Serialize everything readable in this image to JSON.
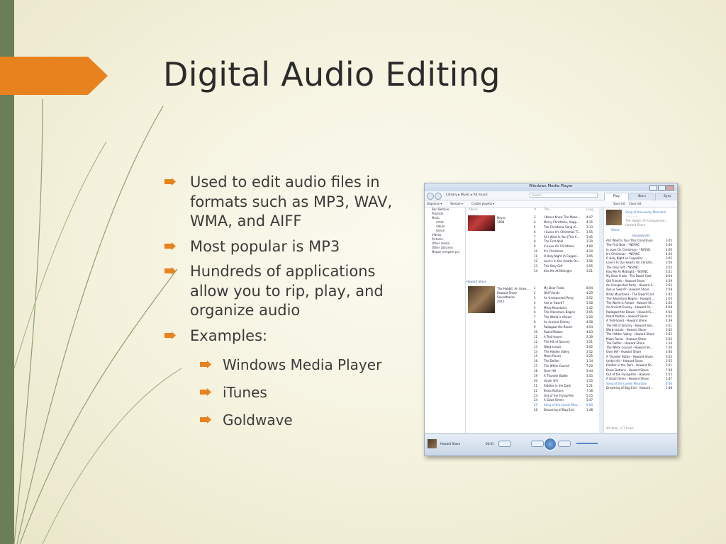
{
  "slide": {
    "title": "Digital Audio Editing",
    "bullets": [
      {
        "level": 1,
        "text": "Used to edit audio files in formats such as MP3, WAV, WMA, and AIFF"
      },
      {
        "level": 1,
        "text": "Most popular is MP3"
      },
      {
        "level": 1,
        "text": "Hundreds of applications allow you to rip, play, and organize audio"
      },
      {
        "level": 1,
        "text": "Examples:"
      },
      {
        "level": 2,
        "text": "Windows Media Player"
      },
      {
        "level": 2,
        "text": "iTunes"
      },
      {
        "level": 2,
        "text": "Goldwave"
      }
    ],
    "colors": {
      "accent": "#e8821e",
      "left_bar": "#6a7f55",
      "curves": "#8a9a6a",
      "bullet": "#e8821e"
    }
  },
  "wmp": {
    "window_title": "Windows Media Player",
    "breadcrumb": "Library ▸ Music ▸ All music",
    "search_placeholder": "Search",
    "tabs": [
      "Play",
      "Burn",
      "Sync"
    ],
    "toolbar": {
      "organize": "Organize ▾",
      "stream": "Stream ▾",
      "create_playlist": "Create playlist ▾",
      "save_list": "Save list",
      "clear_list": "Clear list"
    },
    "nav_items": [
      "Ben Beltone",
      "Playlists",
      "Music",
      "Artist",
      "Album",
      "Genre",
      "Videos",
      "Pictures",
      "Other media",
      "Other Libraries",
      "Megan (megam-pc)"
    ],
    "columns": {
      "album": "Album",
      "num": "#",
      "title": "Title",
      "length": "Leng..."
    },
    "album1": {
      "title": "Nsync",
      "year": "1998",
      "group": ""
    },
    "album1_tracks": [
      [
        "3",
        "I Never Knew The Mean...",
        "4:47"
      ],
      [
        "4",
        "Merry Christmas, Happ...",
        "4:15"
      ],
      [
        "5",
        "The Christmas Song (C...",
        "3:13"
      ],
      [
        "6",
        "I Guess It's Christmas Ti...",
        "3:55"
      ],
      [
        "7",
        "All I Want Is You (This C...",
        "3:45"
      ],
      [
        "8",
        "The First Noel",
        "3:30"
      ],
      [
        "9",
        "In Love On Christmas",
        "4:00"
      ],
      [
        "10",
        "It's Christmas",
        "4:20"
      ],
      [
        "11",
        "O Holy Night (A Cappel...",
        "3:05"
      ],
      [
        "12",
        "Love's In Our Hearts On...",
        "3:56"
      ],
      [
        "13",
        "The Only Gift",
        "3:55"
      ],
      [
        "14",
        "Kiss Me At Midnight",
        "3:21"
      ]
    ],
    "album2": {
      "group": "Howard Shore",
      "title": "The Hobbit: An Unex...",
      "artist": "Howard Shore",
      "genre": "Soundtracks",
      "year": "2012"
    },
    "album2_tracks": [
      [
        "1",
        "My Dear Frodo",
        "8:04"
      ],
      [
        "2",
        "Old Friends",
        "4:29"
      ],
      [
        "3",
        "An Unexpected Party",
        "3:52"
      ],
      [
        "4",
        "Axe or Sword?",
        "5:58"
      ],
      [
        "5",
        "Misty Mountains",
        "1:42"
      ],
      [
        "6",
        "The Adventure Begins",
        "2:05"
      ],
      [
        "7",
        "The World is Ahead",
        "2:20"
      ],
      [
        "8",
        "An Ancient Enemy",
        "4:58"
      ],
      [
        "9",
        "Radagast the Brown",
        "4:54"
      ],
      [
        "10",
        "Roast Mutton",
        "4:03"
      ],
      [
        "11",
        "A Troll-hoard",
        "2:39"
      ],
      [
        "12",
        "The Hill of Sorcery",
        "3:51"
      ],
      [
        "13",
        "Warg-scouts",
        "3:02"
      ],
      [
        "14",
        "The Hidden Valley",
        "3:52"
      ],
      [
        "15",
        "Moon Runes",
        "3:25"
      ],
      [
        "16",
        "The Defiler",
        "1:14"
      ],
      [
        "17",
        "The White Council",
        "7:20"
      ],
      [
        "18",
        "Over Hill",
        "3:44"
      ],
      [
        "19",
        "A Thunder Battle",
        "3:55"
      ],
      [
        "20",
        "Under Hill",
        "1:55"
      ],
      [
        "21",
        "Riddles in the Dark",
        "5:21"
      ],
      [
        "22",
        "Brass Buttons",
        "7:38"
      ],
      [
        "23",
        "Out of the Frying-Pan",
        "5:55"
      ],
      [
        "24",
        "A Good Omen",
        "5:47"
      ],
      [
        "25",
        "Song of the Lonely Mou...",
        "6:00"
      ],
      [
        "26",
        "Dreaming of Bag End",
        "1:48"
      ]
    ],
    "now_playing": {
      "song": "Song of the Lonely Mountain",
      "album": "The Hobbit: An Unexpected...",
      "artist": "Howard Shore",
      "share": "Share"
    },
    "unsaved_list": "Unsaved list",
    "playlist": [
      [
        "All I Want Is You (This Christmas)",
        "3:45"
      ],
      [
        "The First Noel - *NSYNC",
        "3:30"
      ],
      [
        "In Love On Christmas - *NSYNC",
        "4:00"
      ],
      [
        "It's Christmas - *NSYNC",
        "4:20"
      ],
      [
        "O Holy Night (A Cappella)",
        "3:05"
      ],
      [
        "Love's In Our Hearts On Christm...",
        "3:56"
      ],
      [
        "The Only Gift - *NSYNC",
        "3:55"
      ],
      [
        "Kiss Me At Midnight - *NSYNC",
        "3:21"
      ],
      [
        "My Dear Frodo - The Dwarf Cast",
        "8:04"
      ],
      [
        "Old Friends - Howard Shore",
        "4:29"
      ],
      [
        "An Unexpected Party - Howard S...",
        "3:52"
      ],
      [
        "Axe or Sword? - Howard Shore",
        "5:58"
      ],
      [
        "Misty Mountains - The Dwarf Cast",
        "1:42"
      ],
      [
        "The Adventure Begins - Howard ...",
        "2:05"
      ],
      [
        "The World is Ahead - Howard Sh...",
        "2:20"
      ],
      [
        "An Ancient Enemy - Howard Sh...",
        "4:58"
      ],
      [
        "Radagast the Brown - Howard S...",
        "4:54"
      ],
      [
        "Roast Mutton - Howard Shore",
        "4:03"
      ],
      [
        "A Troll-hoard - Howard Shore",
        "2:39"
      ],
      [
        "The Hill of Sorcery - Howard Sho...",
        "3:51"
      ],
      [
        "Warg-scouts - Howard Shore",
        "3:02"
      ],
      [
        "The Hidden Valley - Howard Shore",
        "3:52"
      ],
      [
        "Moon Runes - Howard Shore",
        "3:25"
      ],
      [
        "The Defiler - Howard Shore",
        "1:14"
      ],
      [
        "The White Council - Howard Sh...",
        "7:20"
      ],
      [
        "Over Hill - Howard Shore",
        "3:44"
      ],
      [
        "A Thunder Battle - Howard Shore",
        "3:55"
      ],
      [
        "Under Hill - Howard Shore",
        "1:55"
      ],
      [
        "Riddles in the Dark - Howard Sh...",
        "5:21"
      ],
      [
        "Brass Buttons - Howard Shore",
        "7:38"
      ],
      [
        "Out of the Frying-Pan - Howard ...",
        "5:55"
      ],
      [
        "A Good Omen - Howard Shore",
        "5:47"
      ],
      [
        "Song of the Lonely Mountain",
        "6:00"
      ],
      [
        "Dreaming of Bag End - Howard ...",
        "1:48"
      ]
    ],
    "list_footer": "40 items, 2.7 hours",
    "player": {
      "artist": "Howard Shore",
      "time": "06:01"
    }
  }
}
